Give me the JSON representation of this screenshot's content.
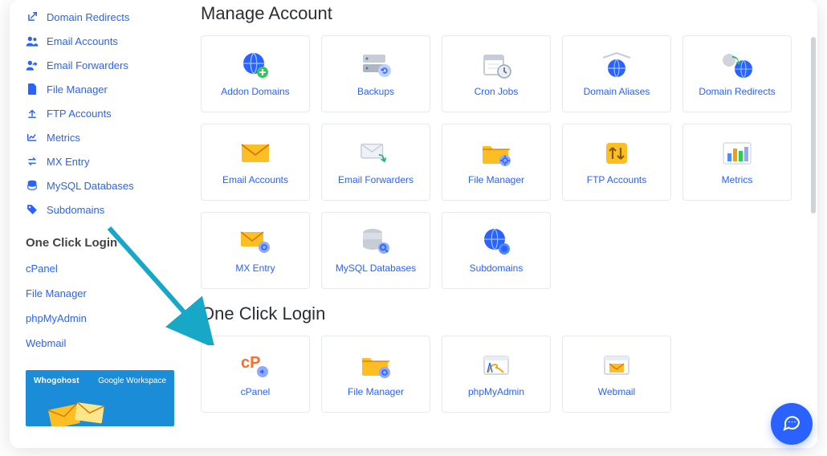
{
  "sidebar": {
    "items": [
      {
        "label": "Domain Redirects",
        "icon": "redirect-icon"
      },
      {
        "label": "Email Accounts",
        "icon": "users-icon"
      },
      {
        "label": "Email Forwarders",
        "icon": "users-share-icon"
      },
      {
        "label": "File Manager",
        "icon": "file-icon"
      },
      {
        "label": "FTP Accounts",
        "icon": "upload-icon"
      },
      {
        "label": "Metrics",
        "icon": "chart-icon"
      },
      {
        "label": "MX Entry",
        "icon": "swap-icon"
      },
      {
        "label": "MySQL Databases",
        "icon": "database-icon"
      },
      {
        "label": "Subdomains",
        "icon": "tag-icon"
      }
    ],
    "login_heading": "One Click Login",
    "login_items": [
      {
        "label": "cPanel"
      },
      {
        "label": "File Manager"
      },
      {
        "label": "phpMyAdmin"
      },
      {
        "label": "Webmail"
      }
    ]
  },
  "promo": {
    "brand_left": "Whogohost",
    "brand_right": "Google Workspace"
  },
  "sections": {
    "manage_title": "Manage Account",
    "login_title": "One Click Login"
  },
  "manage_cards": [
    {
      "label": "Addon Domains"
    },
    {
      "label": "Backups"
    },
    {
      "label": "Cron Jobs"
    },
    {
      "label": "Domain Aliases"
    },
    {
      "label": "Domain Redirects"
    },
    {
      "label": "Email Accounts"
    },
    {
      "label": "Email Forwarders"
    },
    {
      "label": "File Manager"
    },
    {
      "label": "FTP Accounts"
    },
    {
      "label": "Metrics"
    },
    {
      "label": "MX Entry"
    },
    {
      "label": "MySQL Databases"
    },
    {
      "label": "Subdomains"
    }
  ],
  "login_cards": [
    {
      "label": "cPanel"
    },
    {
      "label": "File Manager"
    },
    {
      "label": "phpMyAdmin"
    },
    {
      "label": "Webmail"
    }
  ],
  "colors": {
    "link": "#2962ff",
    "card_border": "#e6e9ee",
    "promo_bg": "#1a8cd8",
    "arrow": "#17a7c7"
  }
}
